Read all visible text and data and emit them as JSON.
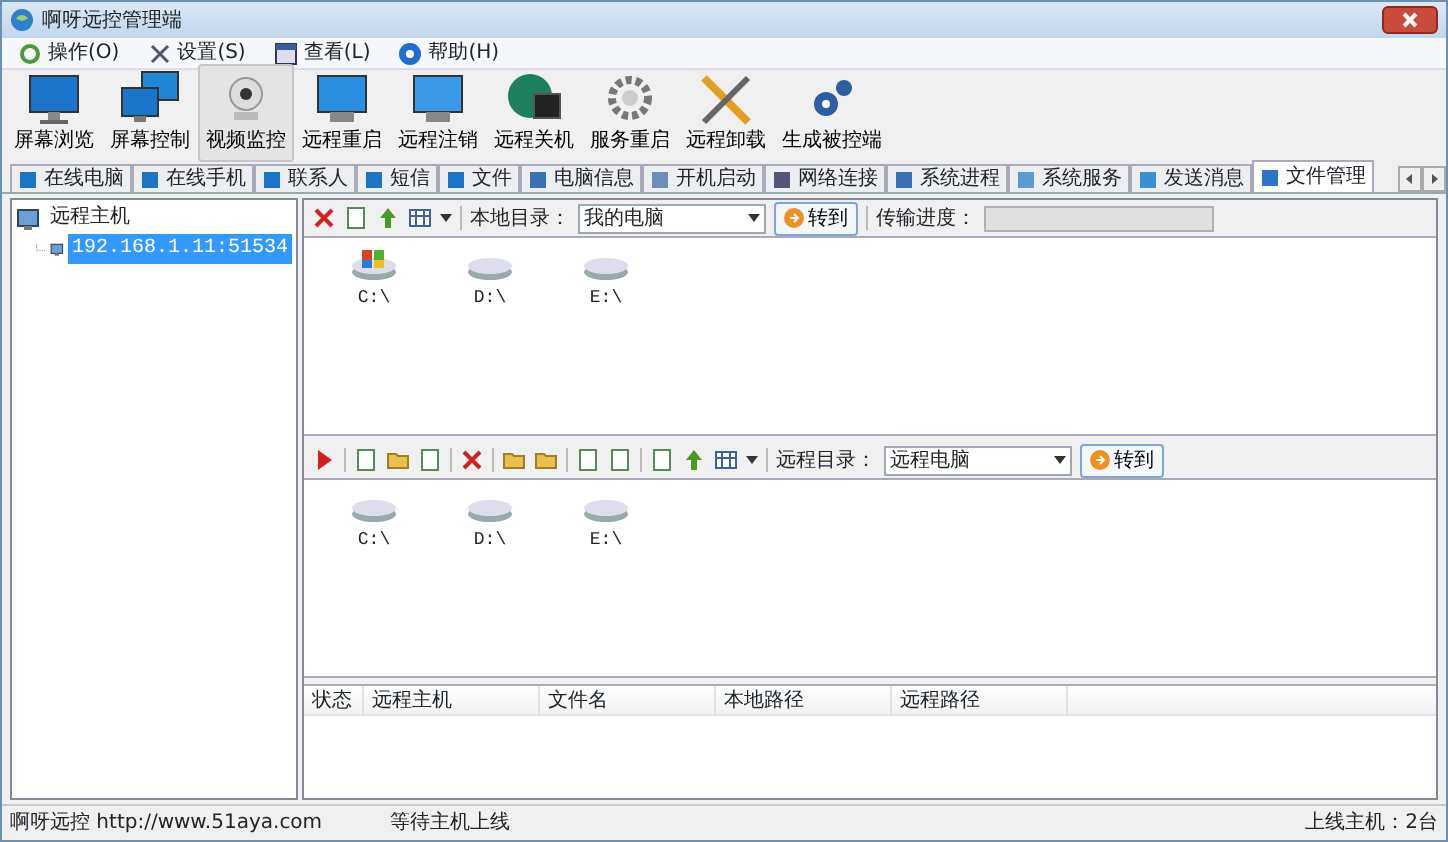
{
  "window": {
    "title": "啊呀远控管理端"
  },
  "menu": [
    {
      "label": "操作(O)"
    },
    {
      "label": "设置(S)"
    },
    {
      "label": "查看(L)"
    },
    {
      "label": "帮助(H)"
    }
  ],
  "toolbar": [
    {
      "label": "屏幕浏览",
      "selected": false
    },
    {
      "label": "屏幕控制",
      "selected": false
    },
    {
      "label": "视频监控",
      "selected": true
    },
    {
      "label": "远程重启",
      "selected": false
    },
    {
      "label": "远程注销",
      "selected": false
    },
    {
      "label": "远程关机",
      "selected": false
    },
    {
      "label": "服务重启",
      "selected": false
    },
    {
      "label": "远程卸载",
      "selected": false
    },
    {
      "label": "生成被控端",
      "selected": false
    }
  ],
  "tabs": [
    {
      "label": "在线电脑",
      "selected": false
    },
    {
      "label": "在线手机",
      "selected": false
    },
    {
      "label": "联系人",
      "selected": false
    },
    {
      "label": "短信",
      "selected": false
    },
    {
      "label": "文件",
      "selected": false
    },
    {
      "label": "电脑信息",
      "selected": false
    },
    {
      "label": "开机启动",
      "selected": false
    },
    {
      "label": "网络连接",
      "selected": false
    },
    {
      "label": "系统进程",
      "selected": false
    },
    {
      "label": "系统服务",
      "selected": false
    },
    {
      "label": "发送消息",
      "selected": false
    },
    {
      "label": "文件管理",
      "selected": true
    }
  ],
  "tree": {
    "label": "远程主机",
    "children": [
      {
        "label": "192.168.1.11:51534",
        "selected": true
      }
    ]
  },
  "local": {
    "dir_label": "本地目录：",
    "dir_value": "我的电脑",
    "go_button": "转到",
    "progress_label": "传输进度：",
    "progress": {
      "level": 0
    },
    "drives": [
      {
        "label": "C:\\",
        "kind": "system"
      },
      {
        "label": "D:\\",
        "kind": "disk"
      },
      {
        "label": "E:\\",
        "kind": "disk"
      }
    ]
  },
  "remote": {
    "dir_label": "远程目录：",
    "dir_value": "远程电脑",
    "go_button": "转到",
    "drives": [
      {
        "label": "C:\\",
        "kind": "disk"
      },
      {
        "label": "D:\\",
        "kind": "disk"
      },
      {
        "label": "E:\\",
        "kind": "disk"
      }
    ]
  },
  "transfers": {
    "columns": [
      "状态",
      "远程主机",
      "文件名",
      "本地路径",
      "远程路径"
    ]
  },
  "status_bar": [
    "啊呀远控 http://www.51aya.com",
    "等待主机上线",
    "上线主机：2台"
  ]
}
